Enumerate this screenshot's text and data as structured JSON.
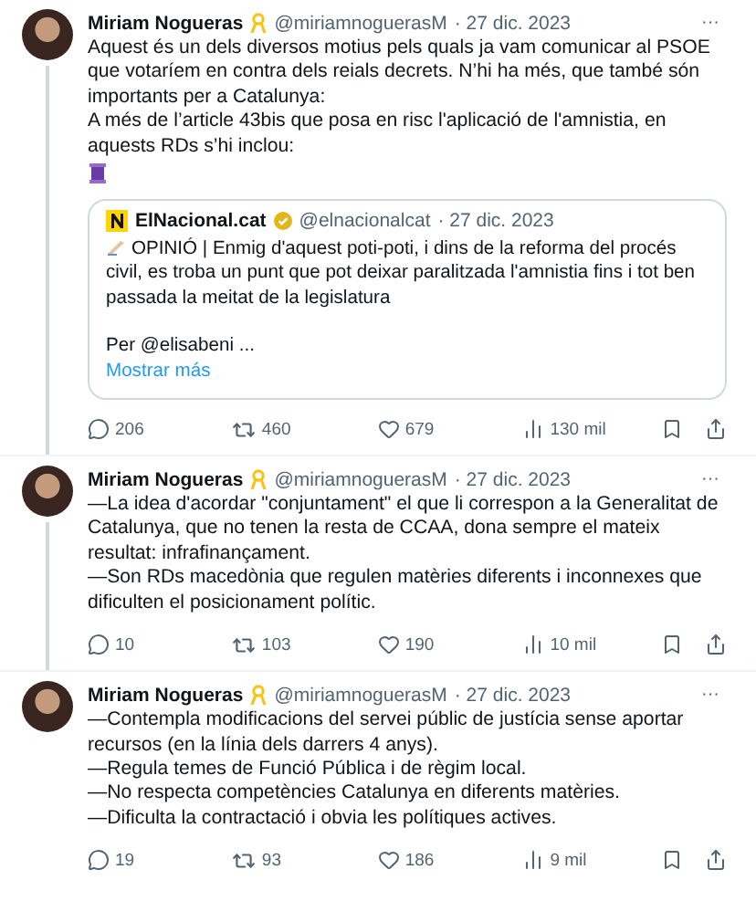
{
  "tweets": [
    {
      "name": "Miriam Nogueras",
      "handle": "@miriamnoguerasM",
      "date": "· 27 dic. 2023",
      "more": "···",
      "thread_line": true,
      "paragraphs": [
        "Aquest és un dels diversos motius pels quals ja vam comunicar al PSOE que votaríem en contra dels reials decrets. N’hi ha més, que també són importants per a Catalunya:",
        "A més de l’article 43bis que posa en risc l'aplicació de l'amnistia, en aquests RDs s’hi inclou:"
      ],
      "spool": true,
      "quote": {
        "name": "ElNacional.cat",
        "handle": "@elnacionalcat",
        "date": "· 27 dic. 2023",
        "text": "OPINIÓ | Enmig d'aquest poti-poti, i dins de la reforma del procés civil, es troba un punt que pot deixar paralitzada l'amnistia fins i tot ben passada la meitat de la legislatura",
        "byline": "Per @elisabeni ...",
        "more_link": "Mostrar más"
      },
      "stats": {
        "replies": "206",
        "reposts": "460",
        "likes": "679",
        "views": "130 mil"
      }
    },
    {
      "name": "Miriam Nogueras",
      "handle": "@miriamnoguerasM",
      "date": "· 27 dic. 2023",
      "more": "···",
      "thread_line": true,
      "paragraphs": [
        "—La idea d'acordar \"conjuntament\" el que li correspon a la Generalitat de Catalunya, que no tenen la resta de CCAA, dona sempre el mateix resultat: infrafinançament.",
        "—Son RDs macedònia que regulen matèries diferents i inconnexes que dificulten el posicionament polític."
      ],
      "spool": false,
      "stats": {
        "replies": "10",
        "reposts": "103",
        "likes": "190",
        "views": "10 mil"
      }
    },
    {
      "name": "Miriam Nogueras",
      "handle": "@miriamnoguerasM",
      "date": "· 27 dic. 2023",
      "more": "···",
      "thread_line": false,
      "paragraphs": [
        "—Contempla modificacions del servei públic de justícia sense aportar recursos (en la línia dels darrers 4 anys).",
        "—Regula temes de Funció Pública i de règim local.",
        "—No respecta competències Catalunya en diferents matèries.",
        "—Dificulta la contractació i obvia les polítiques actives."
      ],
      "spool": false,
      "stats": {
        "replies": "19",
        "reposts": "93",
        "likes": "186",
        "views": "9 mil"
      }
    }
  ]
}
